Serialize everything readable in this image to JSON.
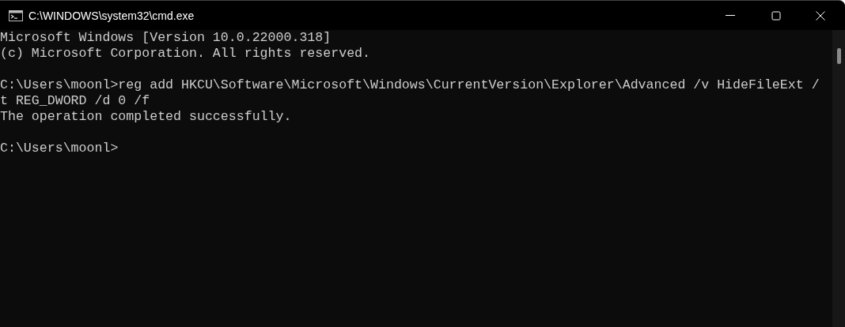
{
  "window": {
    "title": "C:\\WINDOWS\\system32\\cmd.exe"
  },
  "console": {
    "blocks": [
      [
        "Microsoft Windows [Version 10.0.22000.318]",
        "(c) Microsoft Corporation. All rights reserved."
      ],
      [
        "C:\\Users\\moonl>reg add HKCU\\Software\\Microsoft\\Windows\\CurrentVersion\\Explorer\\Advanced /v HideFileExt /",
        "t REG_DWORD /d 0 /f",
        "The operation completed successfully."
      ],
      [
        "C:\\Users\\moonl>"
      ]
    ]
  }
}
